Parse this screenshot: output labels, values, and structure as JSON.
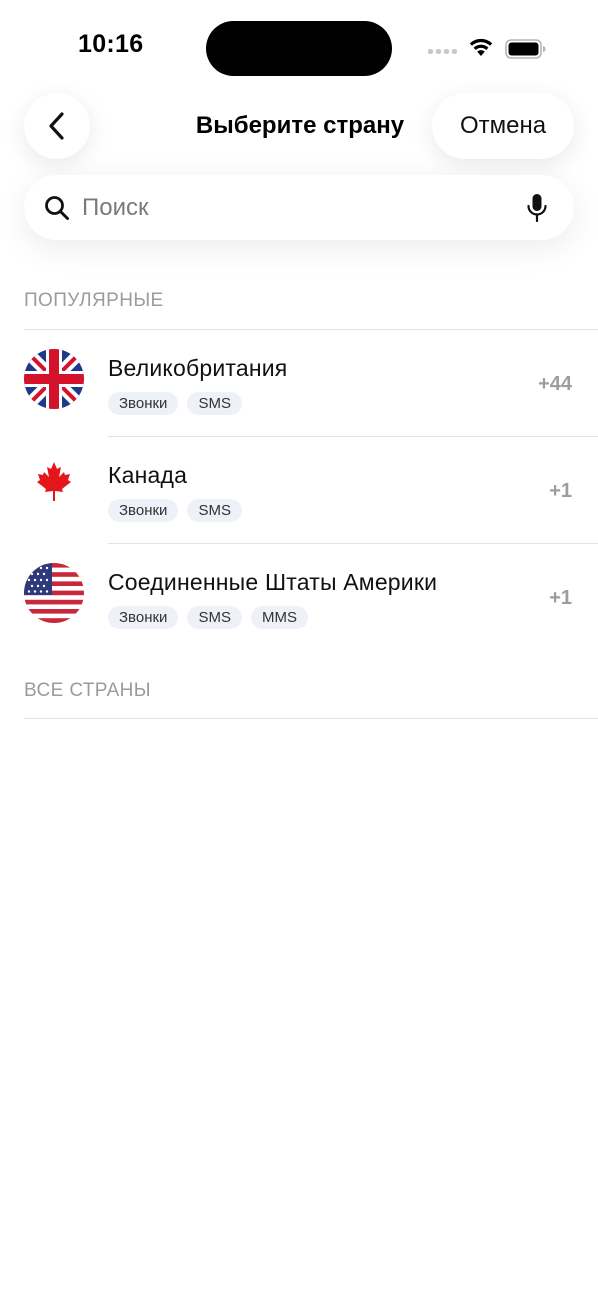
{
  "status_bar": {
    "time": "10:16"
  },
  "nav": {
    "title": "Выберите страну",
    "cancel_label": "Отмена"
  },
  "search": {
    "placeholder": "Поиск",
    "value": ""
  },
  "sections": {
    "popular_header": "ПОПУЛЯРНЫЕ",
    "all_header": "ВСЕ СТРАНЫ"
  },
  "countries": [
    {
      "name": "Великобритания",
      "code": "+44",
      "flag": "uk-flag",
      "tags": [
        "Звонки",
        "SMS"
      ]
    },
    {
      "name": "Канада",
      "code": "+1",
      "flag": "canada-flag",
      "tags": [
        "Звонки",
        "SMS"
      ]
    },
    {
      "name": "Соединенные Штаты Америки",
      "code": "+1",
      "flag": "us-flag",
      "tags": [
        "Звонки",
        "SMS",
        "MMS"
      ]
    }
  ],
  "icons": {
    "back": "chevron-left-icon",
    "search": "search-icon",
    "mic": "microphone-icon"
  },
  "colors": {
    "accent_tag_bg": "#eef1f8",
    "secondary_text": "#9b9b9b"
  }
}
